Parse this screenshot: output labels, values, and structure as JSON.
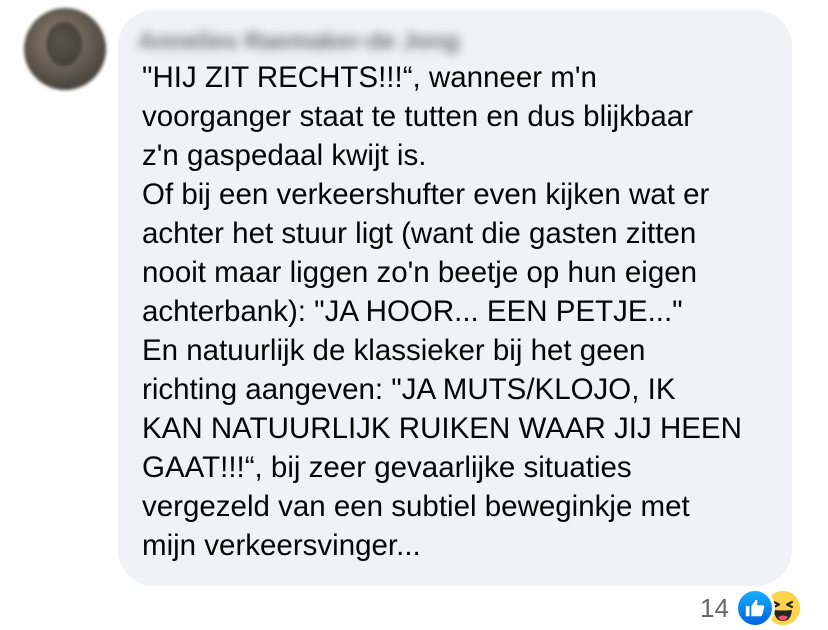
{
  "comment": {
    "author_name": "Annelies Raemaker-de Jong",
    "text_lines": [
      "\"HIJ ZIT RECHTS!!!“, wanneer m'n",
      "voorganger staat te tutten en dus blijkbaar",
      "z'n gaspedaal kwijt is.",
      "Of bij een verkeershufter even kijken wat er",
      "achter het stuur ligt (want die gasten zitten",
      "nooit maar liggen zo'n beetje op hun eigen",
      "achterbank): \"JA HOOR... EEN PETJE...\"",
      "En natuurlijk de klassieker bij het geen",
      "richting aangeven: \"JA MUTS/KLOJO, IK",
      "KAN NATUURLIJK RUIKEN WAAR JIJ HEEN",
      "GAAT!!!“, bij zeer gevaarlijke situaties",
      "vergezeld van een subtiel beweginkje met",
      "mijn verkeersvinger..."
    ]
  },
  "reactions": {
    "count": "14",
    "icons": [
      "like-icon",
      "haha-icon"
    ]
  },
  "colors": {
    "bubble_background": "#f0f2f5",
    "text": "#050505",
    "secondary_text": "#65676b",
    "like_blue": "#0866ff",
    "haha_yellow": "#fcd34d"
  }
}
